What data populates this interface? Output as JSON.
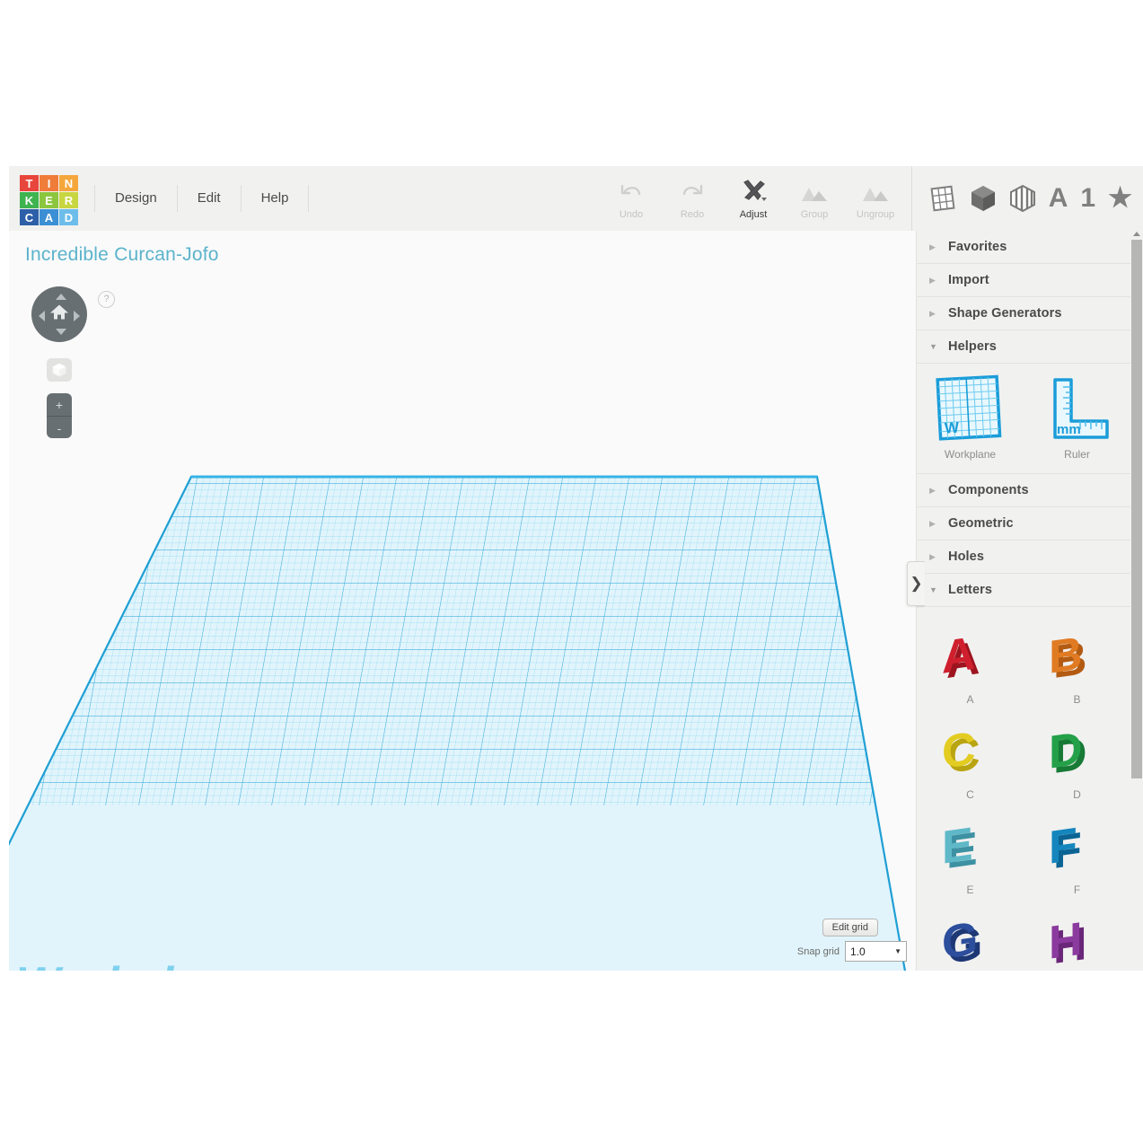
{
  "app": {
    "title": "Tinkercad",
    "design_name": "Incredible Curcan-Jofo"
  },
  "logo": {
    "cells": [
      {
        "letter": "T",
        "color": "#e8453c"
      },
      {
        "letter": "I",
        "color": "#f07c3a"
      },
      {
        "letter": "N",
        "color": "#f5a73c"
      },
      {
        "letter": "K",
        "color": "#3fb34f"
      },
      {
        "letter": "E",
        "color": "#8cc63f"
      },
      {
        "letter": "R",
        "color": "#c8d641"
      },
      {
        "letter": "C",
        "color": "#2d5fa8"
      },
      {
        "letter": "A",
        "color": "#3b8fd4"
      },
      {
        "letter": "D",
        "color": "#6cbdea"
      }
    ]
  },
  "menu": {
    "items": [
      {
        "label": "Design",
        "name": "menu-design"
      },
      {
        "label": "Edit",
        "name": "menu-edit"
      },
      {
        "label": "Help",
        "name": "menu-help"
      }
    ]
  },
  "toolbar": {
    "tools": [
      {
        "label": "Undo",
        "icon": "undo-icon",
        "enabled": false
      },
      {
        "label": "Redo",
        "icon": "redo-icon",
        "enabled": false
      },
      {
        "label": "Adjust",
        "icon": "adjust-icon",
        "enabled": true
      },
      {
        "label": "Group",
        "icon": "group-icon",
        "enabled": false
      },
      {
        "label": "Ungroup",
        "icon": "ungroup-icon",
        "enabled": false
      }
    ]
  },
  "right_icons": [
    {
      "name": "workplane-grid-icon",
      "glyph": ""
    },
    {
      "name": "solid-cube-icon",
      "glyph": ""
    },
    {
      "name": "striped-cube-icon",
      "glyph": ""
    },
    {
      "name": "letter-a-icon",
      "glyph": "A"
    },
    {
      "name": "number-one-icon",
      "glyph": "1"
    },
    {
      "name": "star-icon",
      "glyph": "★"
    }
  ],
  "canvas": {
    "workplane_watermark": "Workplane",
    "help_label": "?",
    "nav_home": "home-icon",
    "zoom_in": "+",
    "zoom_out": "-",
    "edit_grid_label": "Edit grid",
    "snap_grid_label": "Snap grid",
    "snap_grid_value": "1.0",
    "collapse_chevron": "❯",
    "grid_color": "#29abe2",
    "plane_fill": "#ddf2fb"
  },
  "panel": {
    "sections": [
      {
        "label": "Favorites",
        "open": false,
        "name": "section-favorites"
      },
      {
        "label": "Import",
        "open": false,
        "name": "section-import"
      },
      {
        "label": "Shape Generators",
        "open": false,
        "name": "section-shape-generators"
      },
      {
        "label": "Helpers",
        "open": true,
        "name": "section-helpers"
      },
      {
        "label": "Components",
        "open": false,
        "name": "section-components"
      },
      {
        "label": "Geometric",
        "open": false,
        "name": "section-geometric"
      },
      {
        "label": "Holes",
        "open": false,
        "name": "section-holes"
      },
      {
        "label": "Letters",
        "open": true,
        "name": "section-letters"
      }
    ],
    "helpers": [
      {
        "label": "Workplane",
        "badge": "W",
        "name": "shape-workplane"
      },
      {
        "label": "Ruler",
        "badge": "mm",
        "name": "shape-ruler"
      }
    ],
    "letters": [
      {
        "label": "A",
        "color": "#cf1f2e",
        "dark": "#9c141f"
      },
      {
        "label": "B",
        "color": "#e07b24",
        "dark": "#b35b12"
      },
      {
        "label": "C",
        "color": "#e3cc21",
        "dark": "#b9a412"
      },
      {
        "label": "D",
        "color": "#24a049",
        "dark": "#177a35"
      },
      {
        "label": "E",
        "color": "#5fb8c8",
        "dark": "#3d91a2"
      },
      {
        "label": "F",
        "color": "#1486bd",
        "dark": "#0b6493"
      },
      {
        "label": "G",
        "color": "#2c4e9c",
        "dark": "#1d3875"
      },
      {
        "label": "H",
        "color": "#8b3a9e",
        "dark": "#6a2678"
      }
    ],
    "open_triangle": "▼",
    "closed_triangle": "▶"
  }
}
